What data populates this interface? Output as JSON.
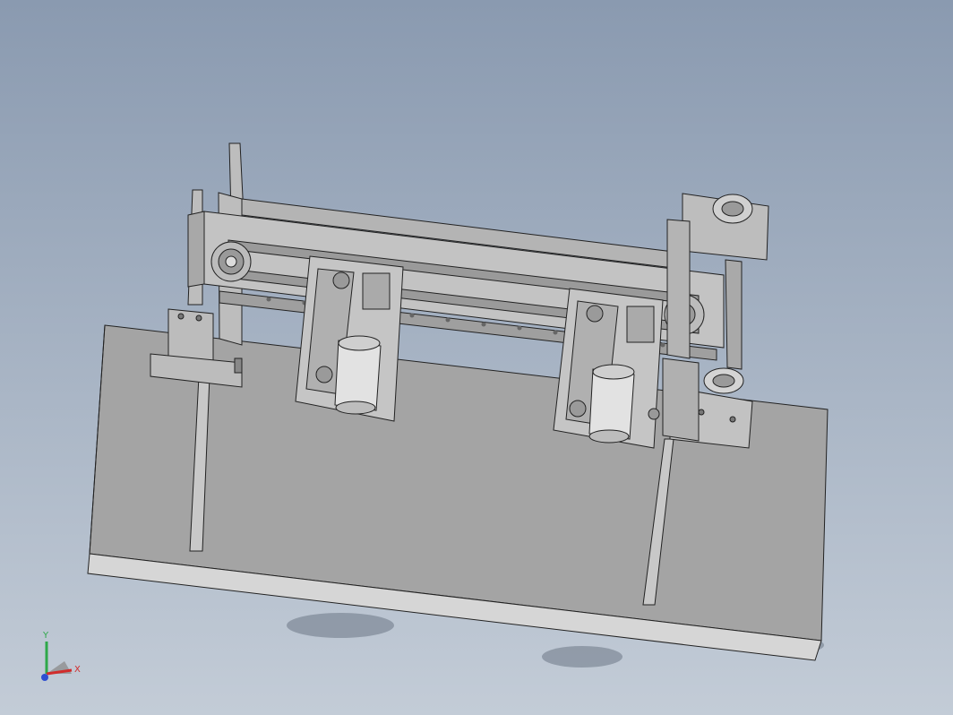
{
  "viewport": {
    "type": "cad-3d-view",
    "background_top": "#8a9ab0",
    "background_bottom": "#c3ccd7"
  },
  "triad": {
    "x_label": "X",
    "y_label": "Y",
    "x_color": "#d12c2c",
    "y_color": "#2ea84a",
    "z_color": "#2f4fd1"
  },
  "model": {
    "part_color": "#b7b7b7",
    "edge_color": "#222222",
    "base_plate_color": "#a3a3a3"
  }
}
